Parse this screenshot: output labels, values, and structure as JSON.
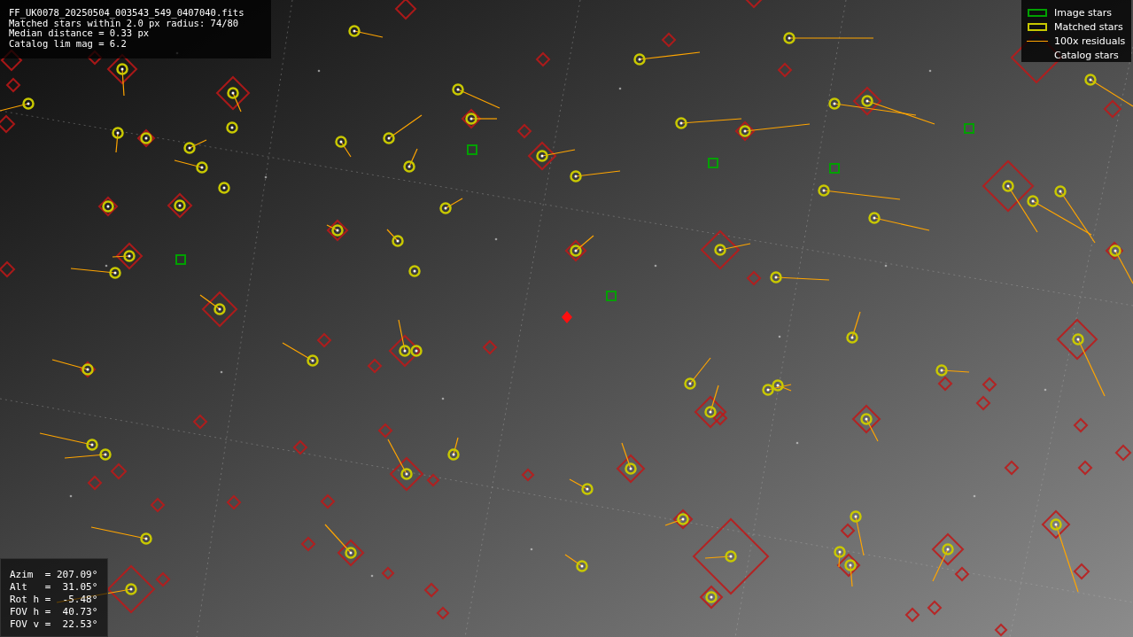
{
  "info_panel": {
    "lines": [
      "FF_UK0078_20250504_003543_549_0407040.fits",
      "Matched stars within 2.0 px radius: 74/80",
      "Median distance = 0.33 px",
      "Catalog lim mag = 6.2"
    ]
  },
  "legend": {
    "items": [
      {
        "label": "Image stars",
        "kind": "box",
        "color": "#00a000"
      },
      {
        "label": "Matched stars",
        "kind": "box",
        "color": "#c8c800"
      },
      {
        "label": "100x residuals",
        "kind": "line",
        "color": "#ffa500"
      },
      {
        "label": "Catalog stars",
        "kind": "none"
      }
    ]
  },
  "pointing_panel": {
    "lines": [
      "Azim  = 207.09°",
      "Alt   =  31.05°",
      "Rot h =  -5.48°",
      "FOV h =  40.73°",
      "FOV v =  22.53°"
    ]
  }
}
